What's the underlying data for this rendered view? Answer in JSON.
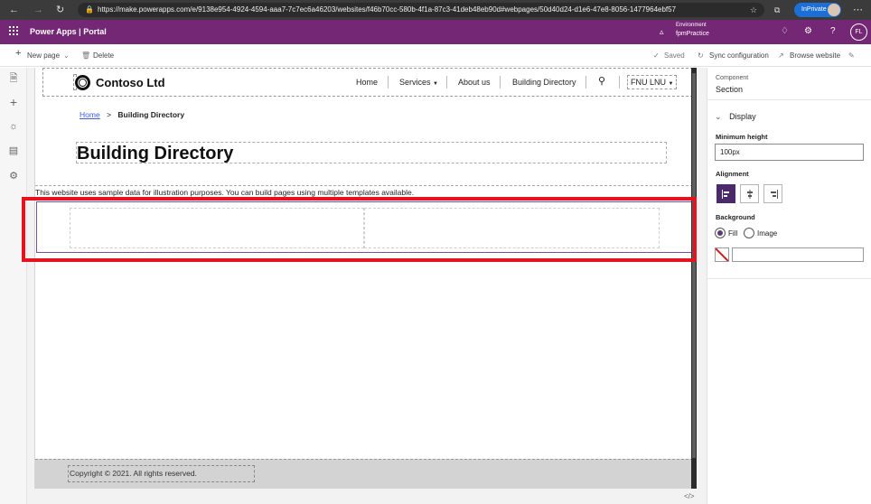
{
  "browser": {
    "url": "https://make.powerapps.com/e/9138e954-4924-4594-aaa7-7c7ec6a46203/websites/f46b70cc-580b-4f1a-87c3-41deb48eb90d#webpages/50d40d24-d1e6-47e8-8056-1477964ebf57",
    "inprivate_label": "InPrivate"
  },
  "app_bar": {
    "title": "Power Apps  |  Portal",
    "environment_label": "Environment",
    "environment_name": "fpmPractice",
    "user_initials": "FL"
  },
  "command_bar": {
    "new_page": "New page",
    "delete": "Delete",
    "saved": "Saved",
    "sync": "Sync configuration",
    "browse": "Browse website"
  },
  "site": {
    "logo_text": "Contoso Ltd",
    "nav": {
      "home": "Home",
      "services": "Services",
      "about": "About us",
      "directory": "Building Directory",
      "user": "FNU LNU"
    },
    "breadcrumb": {
      "home": "Home",
      "separator": ">",
      "current": "Building Directory"
    },
    "page_title": "Building Directory",
    "sample_text": "This website uses sample data for illustration purposes. You can build pages using multiple templates available.",
    "copyright": "Copyright © 2021. All rights reserved."
  },
  "properties": {
    "component_label": "Component",
    "component_value": "Section",
    "display_heading": "Display",
    "min_height_label": "Minimum height",
    "min_height_value": "100px",
    "alignment_label": "Alignment",
    "background_label": "Background",
    "fill_label": "Fill",
    "image_label": "Image",
    "background_selected": "Fill"
  },
  "colors": {
    "app_bar": "#742774",
    "highlight": "#e6131f",
    "section_border": "#7a4e9a",
    "footer": "#d3d3d3"
  },
  "icons": {
    "code_toggle": "</>"
  }
}
